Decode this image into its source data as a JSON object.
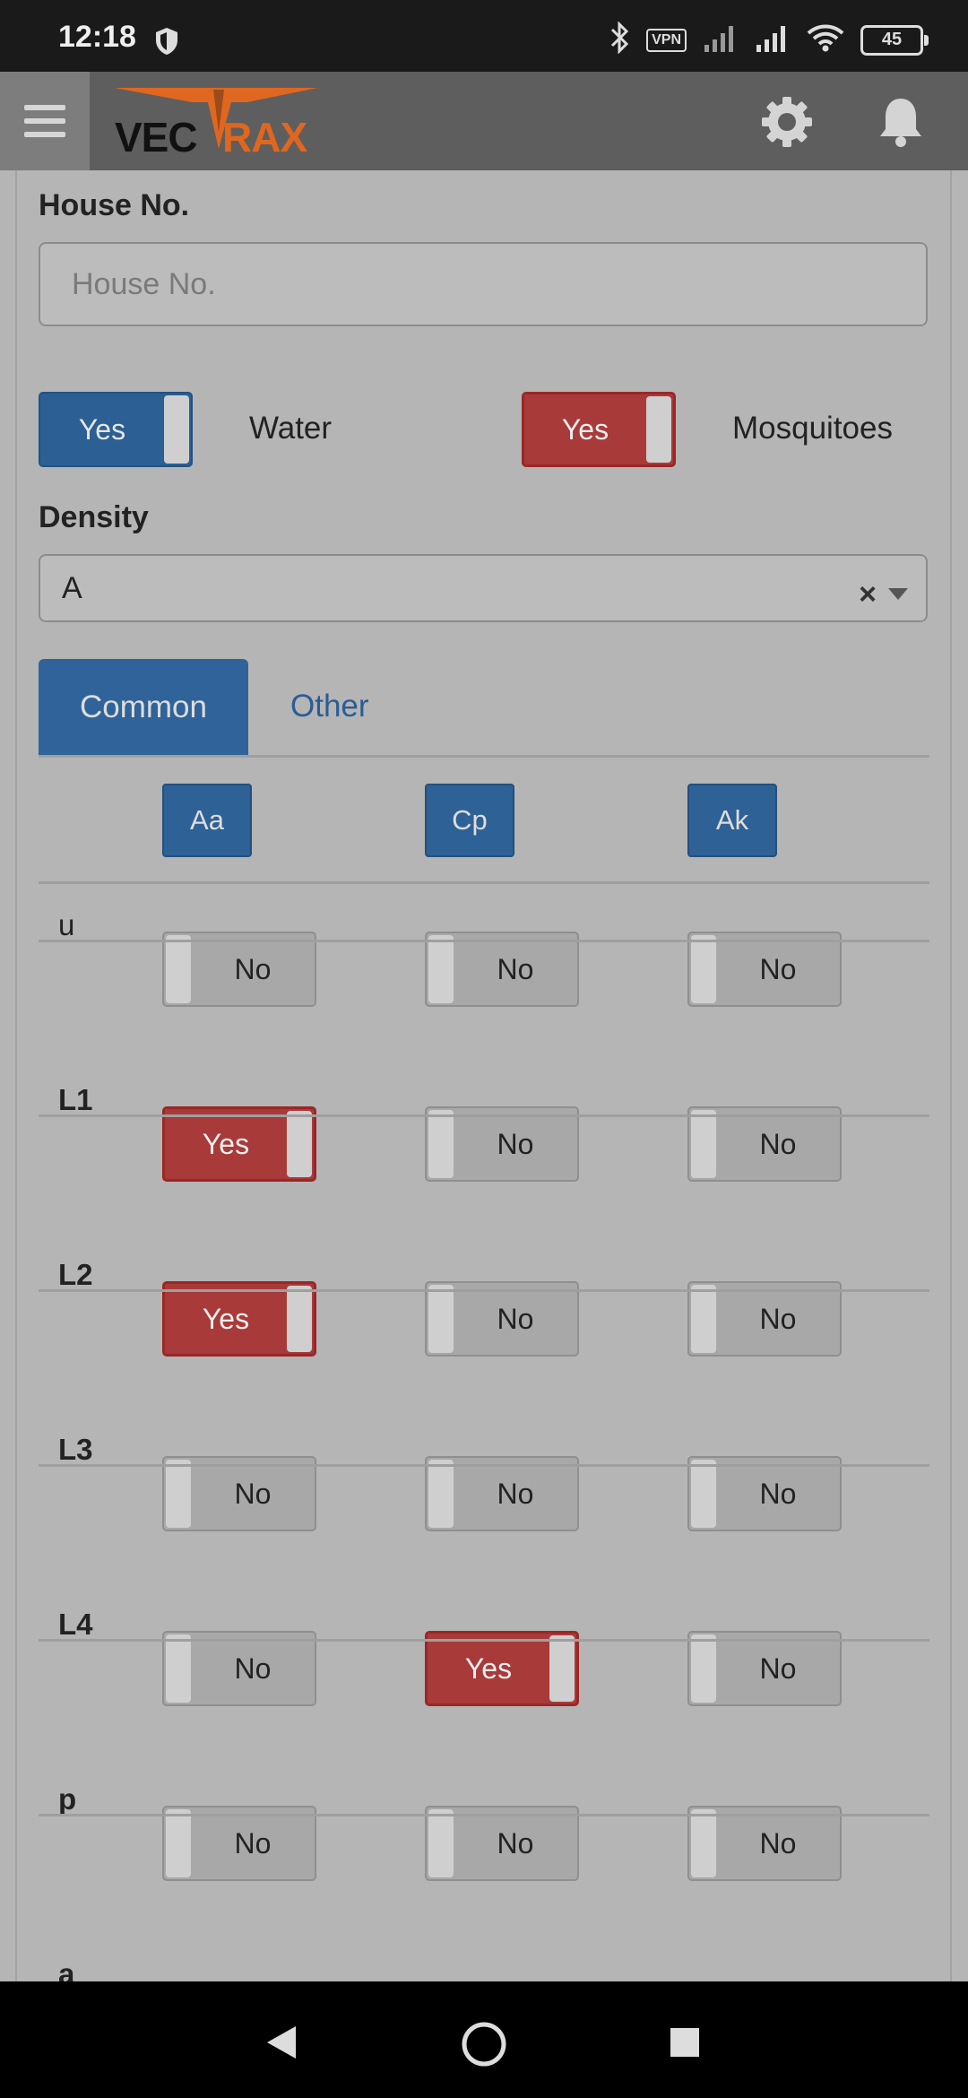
{
  "status_bar": {
    "time": "12:18",
    "vpn": "VPN",
    "battery": "45"
  },
  "app_bar": {
    "logo_left": "VEC",
    "logo_right": "RAX"
  },
  "form": {
    "house_label": "House No.",
    "house_placeholder": "House No.",
    "water_toggle": "Yes",
    "water_label": "Water",
    "mosquito_toggle": "Yes",
    "mosquito_label": "Mosquitoes",
    "density_label": "Density",
    "density_value": "A",
    "density_clear": "×"
  },
  "tabs": {
    "common": "Common",
    "other": "Other"
  },
  "species": [
    "Aa",
    "Cp",
    "Ak"
  ],
  "rows": [
    {
      "label": "u",
      "values": [
        "No",
        "No",
        "No"
      ]
    },
    {
      "label": "L1",
      "values": [
        "Yes",
        "No",
        "No"
      ]
    },
    {
      "label": "L2",
      "values": [
        "Yes",
        "No",
        "No"
      ]
    },
    {
      "label": "L3",
      "values": [
        "No",
        "No",
        "No"
      ]
    },
    {
      "label": "L4",
      "values": [
        "No",
        "Yes",
        "No"
      ]
    },
    {
      "label": "p",
      "values": [
        "No",
        "No",
        "No"
      ]
    },
    {
      "label": "a"
    }
  ],
  "colors": {
    "primary": "#2f6399",
    "danger": "#a93a3a",
    "header": "#5e5e5e",
    "accent_logo": "#e0671f"
  }
}
